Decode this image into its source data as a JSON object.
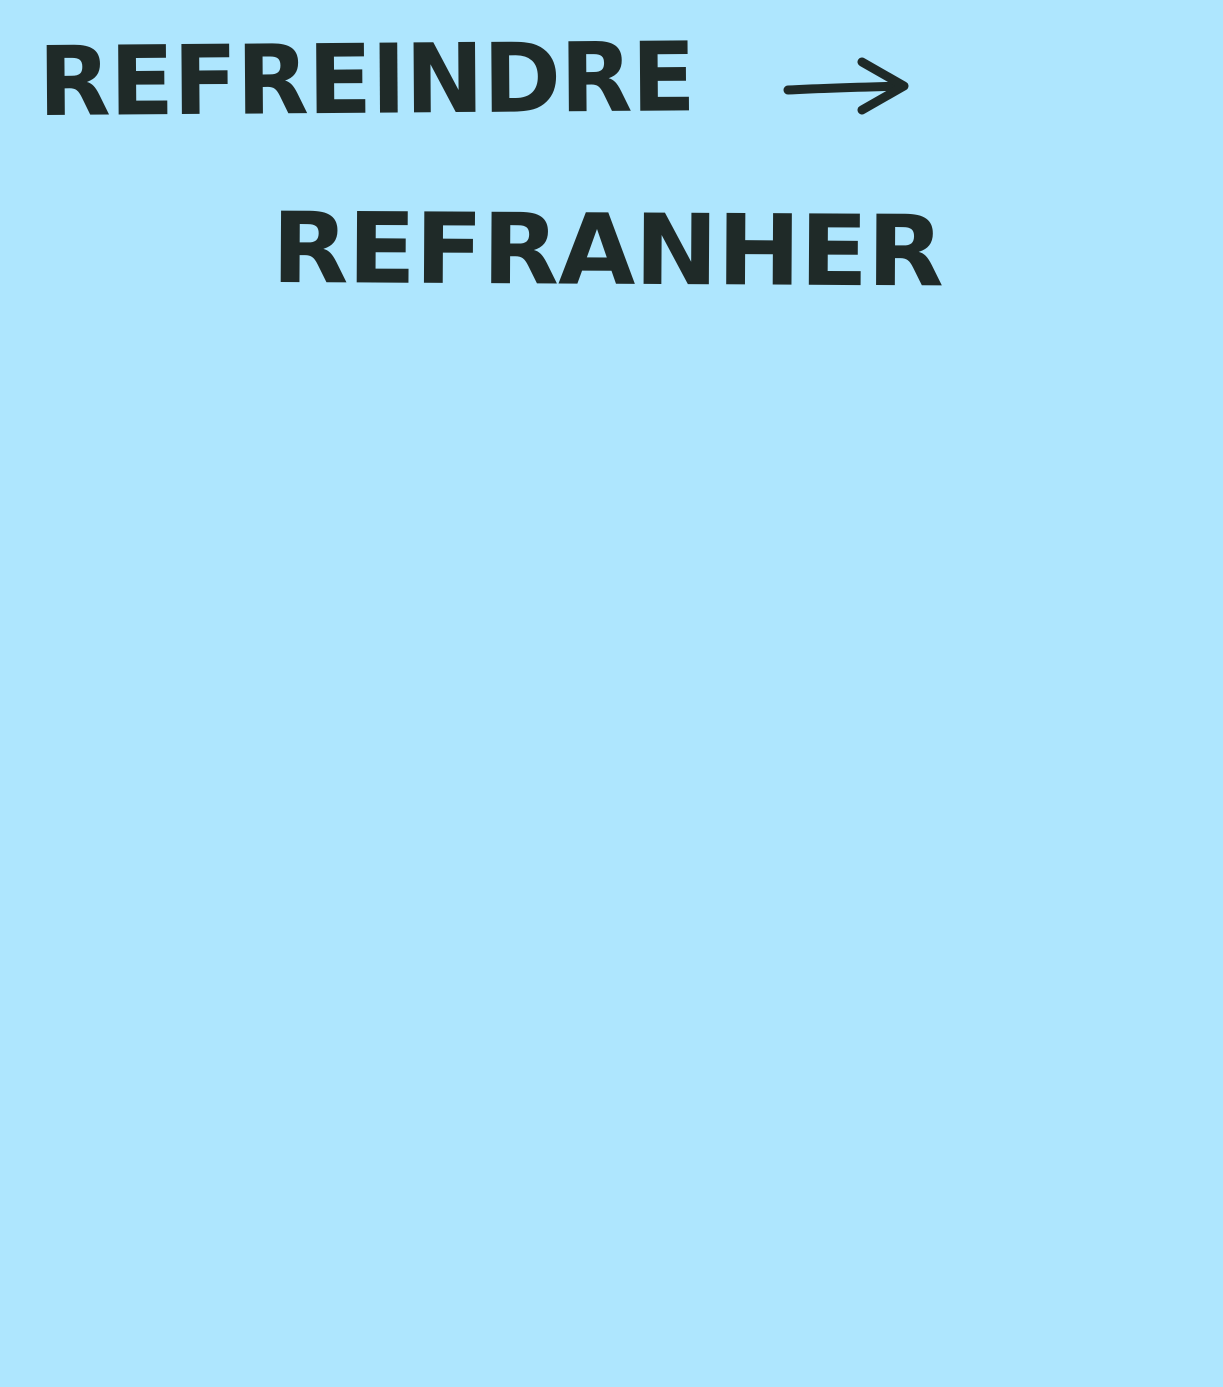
{
  "note": {
    "background_color": "#aee6fe",
    "ink_color": "#1f2a28",
    "line1": "REFREINDRE",
    "arrow_icon": "right-arrow-icon",
    "line2": "REFRANHER"
  }
}
